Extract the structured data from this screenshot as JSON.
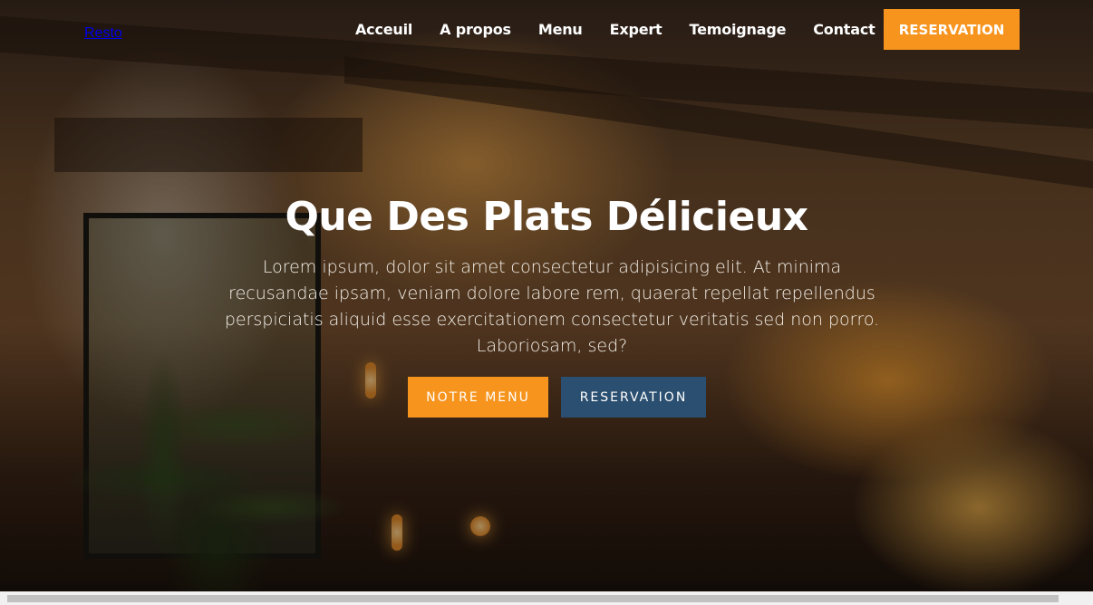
{
  "header": {
    "logo": "Resto",
    "nav": [
      "Acceuil",
      "A propos",
      "Menu",
      "Expert",
      "Temoignage",
      "Contact"
    ],
    "cta": "RESERVATION"
  },
  "hero": {
    "title": "Que Des Plats Délicieux",
    "text": "Lorem ipsum, dolor sit amet consectetur adipisicing elit. At minima recusandae ipsam, veniam dolore labore rem, quaerat repellat repellendus perspiciatis aliquid esse exercitationem consectetur veritatis sed non porro. Laboriosam, sed?",
    "btn_menu": "NOTRE MENU",
    "btn_reservation": "RESERVATION"
  },
  "colors": {
    "accent": "#f7941d",
    "secondary": "#2b4f70"
  }
}
